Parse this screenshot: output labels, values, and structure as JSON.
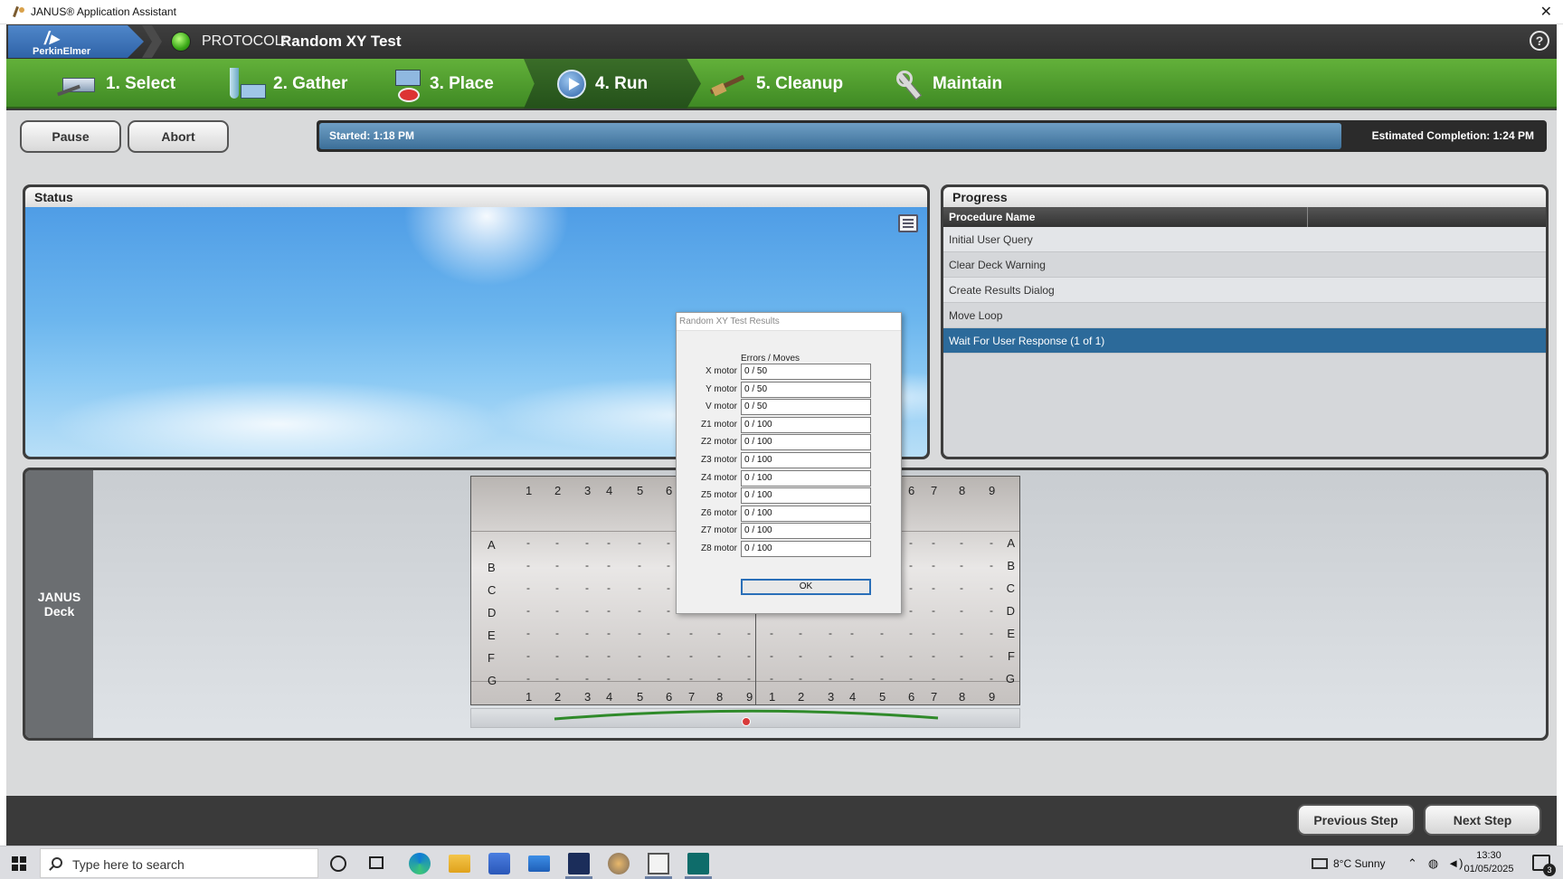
{
  "window": {
    "title": "JANUS® Application Assistant",
    "close_glyph": "✕"
  },
  "header": {
    "logo_mark": "/▸",
    "logo_text": "PerkinElmer",
    "protocol_label": "PROTOCOL:",
    "protocol_name": "Random XY Test",
    "help_glyph": "?",
    "status_color": "#3aa818"
  },
  "steps": [
    {
      "label": "1. Select",
      "icon": "plate-select-icon"
    },
    {
      "label": "2. Gather",
      "icon": "tube-rack-icon"
    },
    {
      "label": "3. Place",
      "icon": "plate-place-icon"
    },
    {
      "label": "4. Run",
      "icon": "play-icon",
      "active": true
    },
    {
      "label": "5. Cleanup",
      "icon": "brush-icon"
    },
    {
      "label": "Maintain",
      "icon": "wrench-icon"
    }
  ],
  "controls": {
    "pause": "Pause",
    "abort": "Abort"
  },
  "timebar": {
    "started": "Started: 1:18 PM",
    "estimated": "Estimated Completion: 1:24 PM"
  },
  "status_panel": {
    "title": "Status"
  },
  "progress_panel": {
    "title": "Progress",
    "column_header": "Procedure Name",
    "rows": [
      "Initial User Query",
      "Clear Deck Warning",
      "Create Results Dialog",
      "Move Loop",
      "Wait For User Response (1 of 1)"
    ],
    "selected_index": 4
  },
  "deck": {
    "label_line1": "JANUS",
    "label_line2": "Deck",
    "columns": [
      "1",
      "2",
      "3",
      "4",
      "5",
      "6",
      "7",
      "8",
      "9"
    ],
    "rows": [
      "A",
      "B",
      "C",
      "D",
      "E",
      "F",
      "G"
    ],
    "empty_cell": "-"
  },
  "dialog": {
    "title": "Random XY Test Results",
    "header": "Errors / Moves",
    "rows": [
      {
        "label": "X motor",
        "value": "0 / 50"
      },
      {
        "label": "Y motor",
        "value": "0 / 50"
      },
      {
        "label": "V motor",
        "value": "0 / 50"
      },
      {
        "label": "Z1 motor",
        "value": "0 / 100"
      },
      {
        "label": "Z2 motor",
        "value": "0 / 100"
      },
      {
        "label": "Z3 motor",
        "value": "0 / 100"
      },
      {
        "label": "Z4 motor",
        "value": "0 / 100"
      },
      {
        "label": "Z5 motor",
        "value": "0 / 100"
      },
      {
        "label": "Z6 motor",
        "value": "0 / 100"
      },
      {
        "label": "Z7 motor",
        "value": "0 / 100"
      },
      {
        "label": "Z8 motor",
        "value": "0 / 100"
      }
    ],
    "ok": "OK"
  },
  "footer": {
    "previous": "Previous Step",
    "next": "Next Step"
  },
  "taskbar": {
    "search_placeholder": "Type here to search",
    "weather": "8°C  Sunny",
    "time": "13:30",
    "date": "01/05/2025",
    "notifications": "3"
  }
}
